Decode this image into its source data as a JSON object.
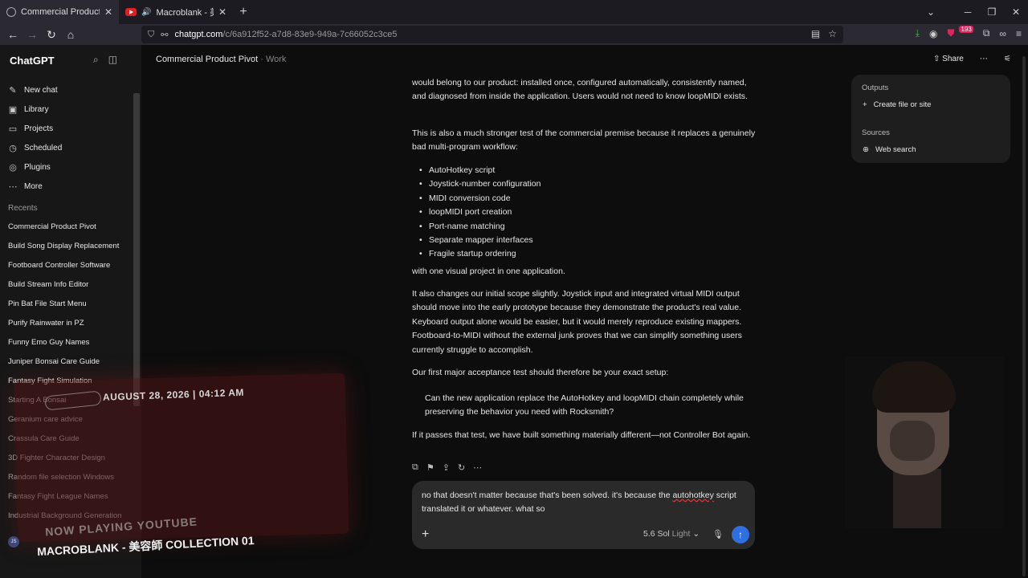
{
  "browser": {
    "tabs": [
      {
        "title": "Commercial Product Pivot",
        "active": true
      },
      {
        "title": "Macroblank - 美容師 COLLE",
        "active": false
      }
    ],
    "url_host": "chatgpt.com",
    "url_path": "/c/6a912f52-a7d8-83e9-949a-7c66052c3ce5",
    "notification_count": "193"
  },
  "sidebar": {
    "brand": "ChatGPT",
    "nav": [
      {
        "label": "New chat",
        "icon": "edit-icon"
      },
      {
        "label": "Library",
        "icon": "library-icon"
      },
      {
        "label": "Projects",
        "icon": "folder-icon"
      },
      {
        "label": "Scheduled",
        "icon": "clock-icon"
      },
      {
        "label": "Plugins",
        "icon": "plugin-icon"
      },
      {
        "label": "More",
        "icon": "more-icon"
      }
    ],
    "recents_label": "Recents",
    "recents": [
      "Commercial Product Pivot",
      "Build Song Display Replacement",
      "Footboard Controller Software",
      "Build Stream Info Editor",
      "Pin Bat File Start Menu",
      "Purify Rainwater in PZ",
      "Funny Emo Guy Names",
      "Juniper Bonsai Care Guide",
      "Fantasy Fight Simulation",
      "Starting A Bonsai",
      "Geranium care advice",
      "Crassula Care Guide",
      "3D Fighter Character Design",
      "Random file selection Windows",
      "Fantasy Fight League Names",
      "Industrial Background Generation"
    ],
    "user_initials": "JS"
  },
  "overlay": {
    "date": "AUGUST 28, 2026 | 04:12 AM",
    "now_playing": "NOW PLAYING YOUTUBE",
    "song": "MACROBLANK - 美容師 COLLECTION 01"
  },
  "header": {
    "title": "Commercial Product Pivot",
    "separator": "·",
    "project": "Work",
    "share": "Share"
  },
  "conversation": {
    "p1": "would belong to our product: installed once, configured automatically, consistently named, and diagnosed from inside the application. Users would not need to know loopMIDI exists.",
    "p2": "This is also a much stronger test of the commercial premise because it replaces a genuinely bad multi-program workflow:",
    "bullets": [
      "AutoHotkey script",
      "Joystick-number configuration",
      "MIDI conversion code",
      "loopMIDI port creation",
      "Port-name matching",
      "Separate mapper interfaces",
      "Fragile startup ordering"
    ],
    "p3": "with one visual project in one application.",
    "p4": "It also changes our initial scope slightly. Joystick input and integrated virtual MIDI output should move into the early prototype because they demonstrate the product's real value. Keyboard output alone would be easier, but it would merely reproduce existing mappers. Footboard-to-MIDI without the external junk proves that we can simplify something users currently struggle to accomplish.",
    "p5": "Our first major acceptance test should therefore be your exact setup:",
    "quote": "Can the new application replace the AutoHotkey and loopMIDI chain completely while preserving the behavior you need with Rocksmith?",
    "p6": "If it passes that test, we have built something materially different—not Controller Bot again."
  },
  "composer": {
    "text_before": "no that doesn't matter because that's been solved. it's because the ",
    "text_misspelled": "autohotkey",
    "text_after": " script translated it or whatever. what so",
    "model": "5.6 Sol",
    "model_variant": "Light"
  },
  "outputs_panel": {
    "outputs_label": "Outputs",
    "create_label": "Create file or site",
    "sources_label": "Sources",
    "web_search_label": "Web search"
  },
  "colors": {
    "accent": "#2f6fe0",
    "background": "#0d0d0d",
    "sidebar": "#171717",
    "composer": "#2a2a2a"
  }
}
